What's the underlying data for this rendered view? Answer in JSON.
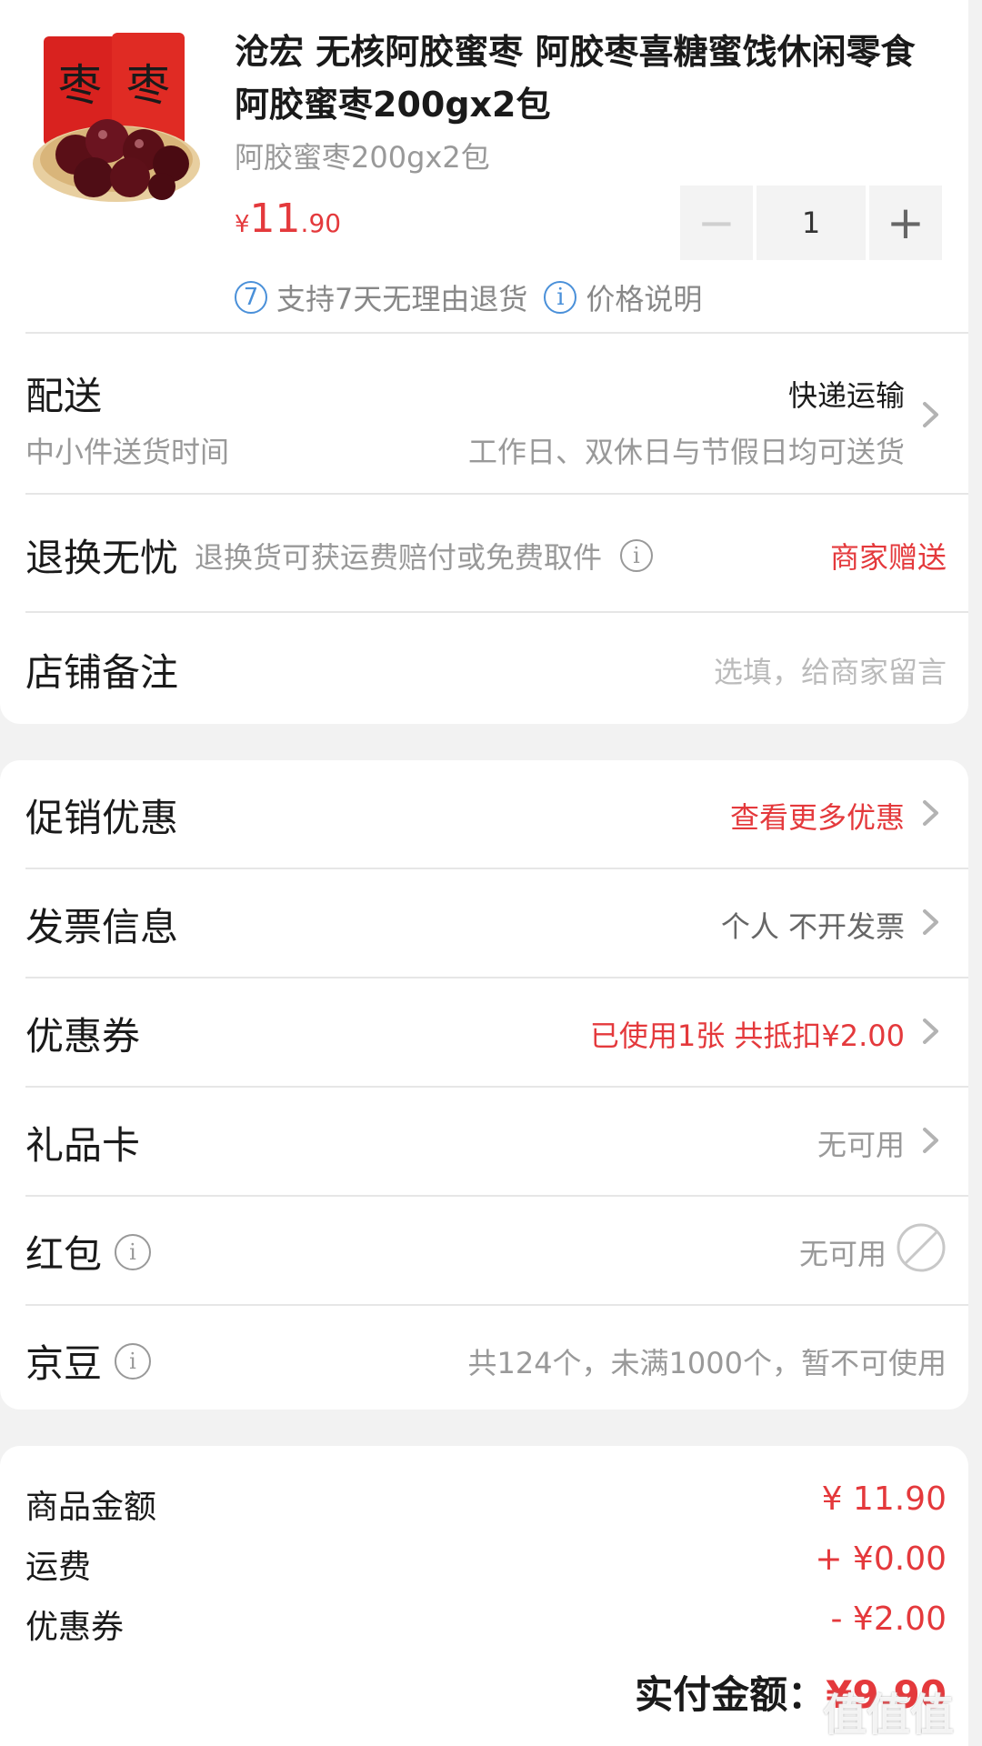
{
  "product": {
    "title": "沧宏 无核阿胶蜜枣 阿胶枣喜糖蜜饯休闲零食阿胶蜜枣200gx2包",
    "spec": "阿胶蜜枣200gx2包",
    "price_symbol": "¥",
    "price_int": "11",
    "price_dec": ".90",
    "quantity": "1",
    "minus": "−",
    "plus": "+",
    "badge_return_num": "7",
    "badge_return": "支持7天无理由退货",
    "badge_price_icon": "i",
    "badge_price": "价格说明"
  },
  "delivery": {
    "label": "配送",
    "method": "快递运输",
    "time_label": "中小件送货时间",
    "time_value": "工作日、双休日与节假日均可送货"
  },
  "returns": {
    "label": "退换无忧",
    "desc": "退换货可获运费赔付或免费取件",
    "value": "商家赠送"
  },
  "note": {
    "label": "店铺备注",
    "placeholder": "选填，给商家留言"
  },
  "options": {
    "promo": {
      "label": "促销优惠",
      "value": "查看更多优惠"
    },
    "invoice": {
      "label": "发票信息",
      "value": "个人 不开发票"
    },
    "coupon": {
      "label": "优惠券",
      "value": "已使用1张 共抵扣¥2.00"
    },
    "giftcard": {
      "label": "礼品卡",
      "value": "无可用"
    },
    "redpacket": {
      "label": "红包",
      "value": "无可用"
    },
    "jingdou": {
      "label": "京豆",
      "value": "共124个，未满1000个，暂不可使用"
    }
  },
  "summary": {
    "goods_label": "商品金额",
    "goods_value": "¥ 11.90",
    "freight_label": "运费",
    "freight_value": "+ ¥0.00",
    "coupon_label": "优惠券",
    "coupon_value": "- ¥2.00",
    "pay_label": "实付金额：",
    "pay_value": "¥9.90"
  },
  "watermark": "值值值",
  "icons": {
    "chevron": "chevron-right-icon",
    "disabled": "prohibited-icon",
    "info": "info-icon"
  },
  "colors": {
    "accent_red": "#e4393c",
    "badge_blue": "#4a90d9"
  }
}
